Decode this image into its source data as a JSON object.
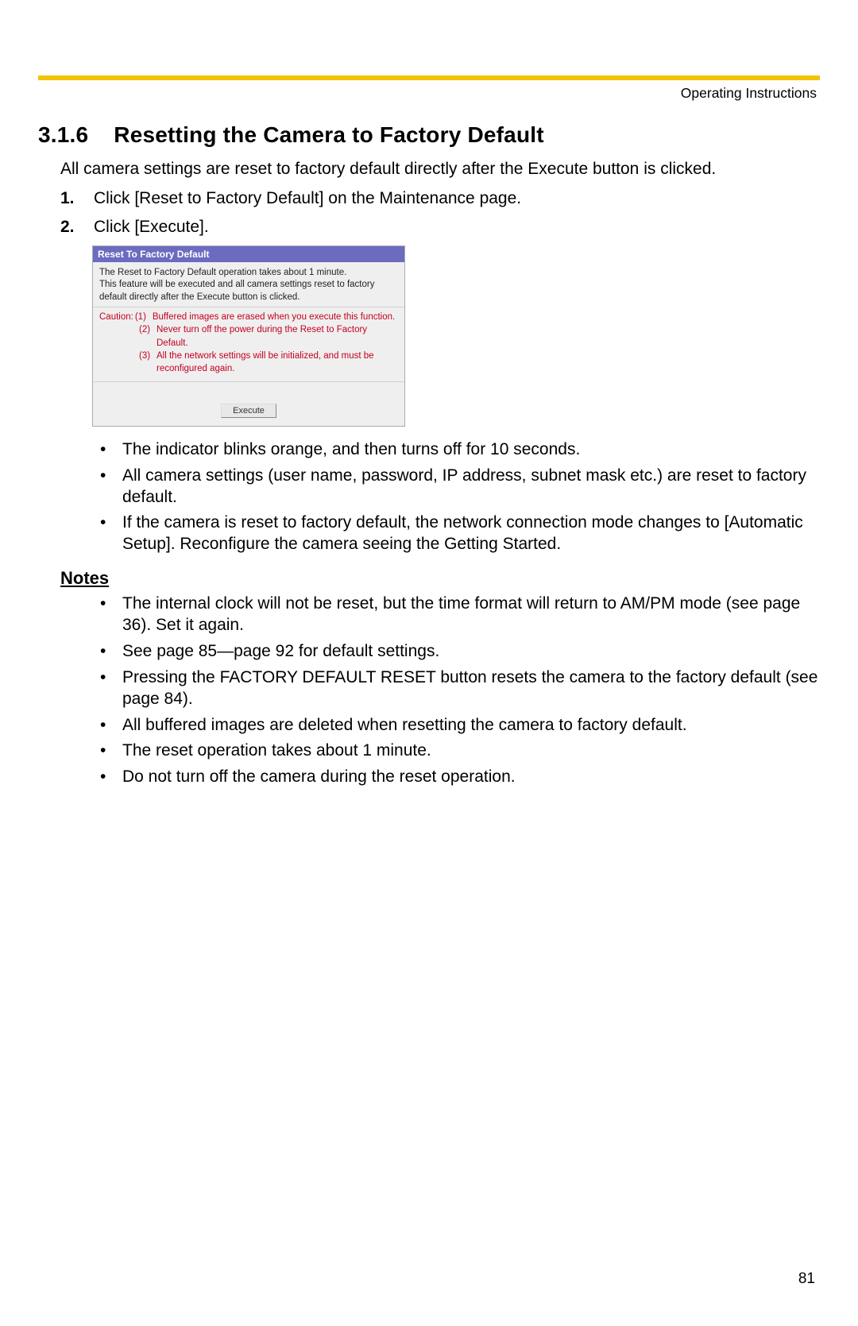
{
  "header": {
    "label": "Operating Instructions"
  },
  "section": {
    "number": "3.1.6",
    "title": "Resetting the Camera to Factory Default",
    "intro": "All camera settings are reset to factory default directly after the Execute button is clicked.",
    "steps": [
      "Click [Reset to Factory Default] on the Maintenance page.",
      "Click [Execute]."
    ]
  },
  "ui_panel": {
    "title": "Reset To Factory Default",
    "desc_line1": "The Reset to Factory Default operation takes about 1 minute.",
    "desc_line2": "This feature will be executed and all camera settings reset to factory default directly after the Execute button is clicked.",
    "caution_label": "Caution:",
    "caution_items": [
      {
        "num": "(1)",
        "text": "Buffered images are erased when you execute this function."
      },
      {
        "num": "(2)",
        "text": "Never turn off the power during the Reset to Factory Default."
      },
      {
        "num": "(3)",
        "text": "All the network settings will be initialized, and must be reconfigured again."
      }
    ],
    "execute_label": "Execute"
  },
  "after_bullets": [
    "The indicator blinks orange, and then turns off for 10 seconds.",
    "All camera settings (user name, password, IP address, subnet mask etc.) are reset to factory default.",
    "If the camera is reset to factory default, the network connection mode changes to [Automatic Setup]. Reconfigure the camera seeing the Getting Started."
  ],
  "notes": {
    "heading": "Notes",
    "items": [
      "The internal clock will not be reset, but the time format will return to AM/PM mode (see page 36). Set it again.",
      "See page 85—page 92 for default settings.",
      "Pressing the FACTORY DEFAULT RESET button resets the camera to the factory default (see page 84).",
      "All buffered images are deleted when resetting the camera to factory default.",
      "The reset operation takes about 1 minute.",
      "Do not turn off the camera during the reset operation."
    ]
  },
  "page_number": "81"
}
